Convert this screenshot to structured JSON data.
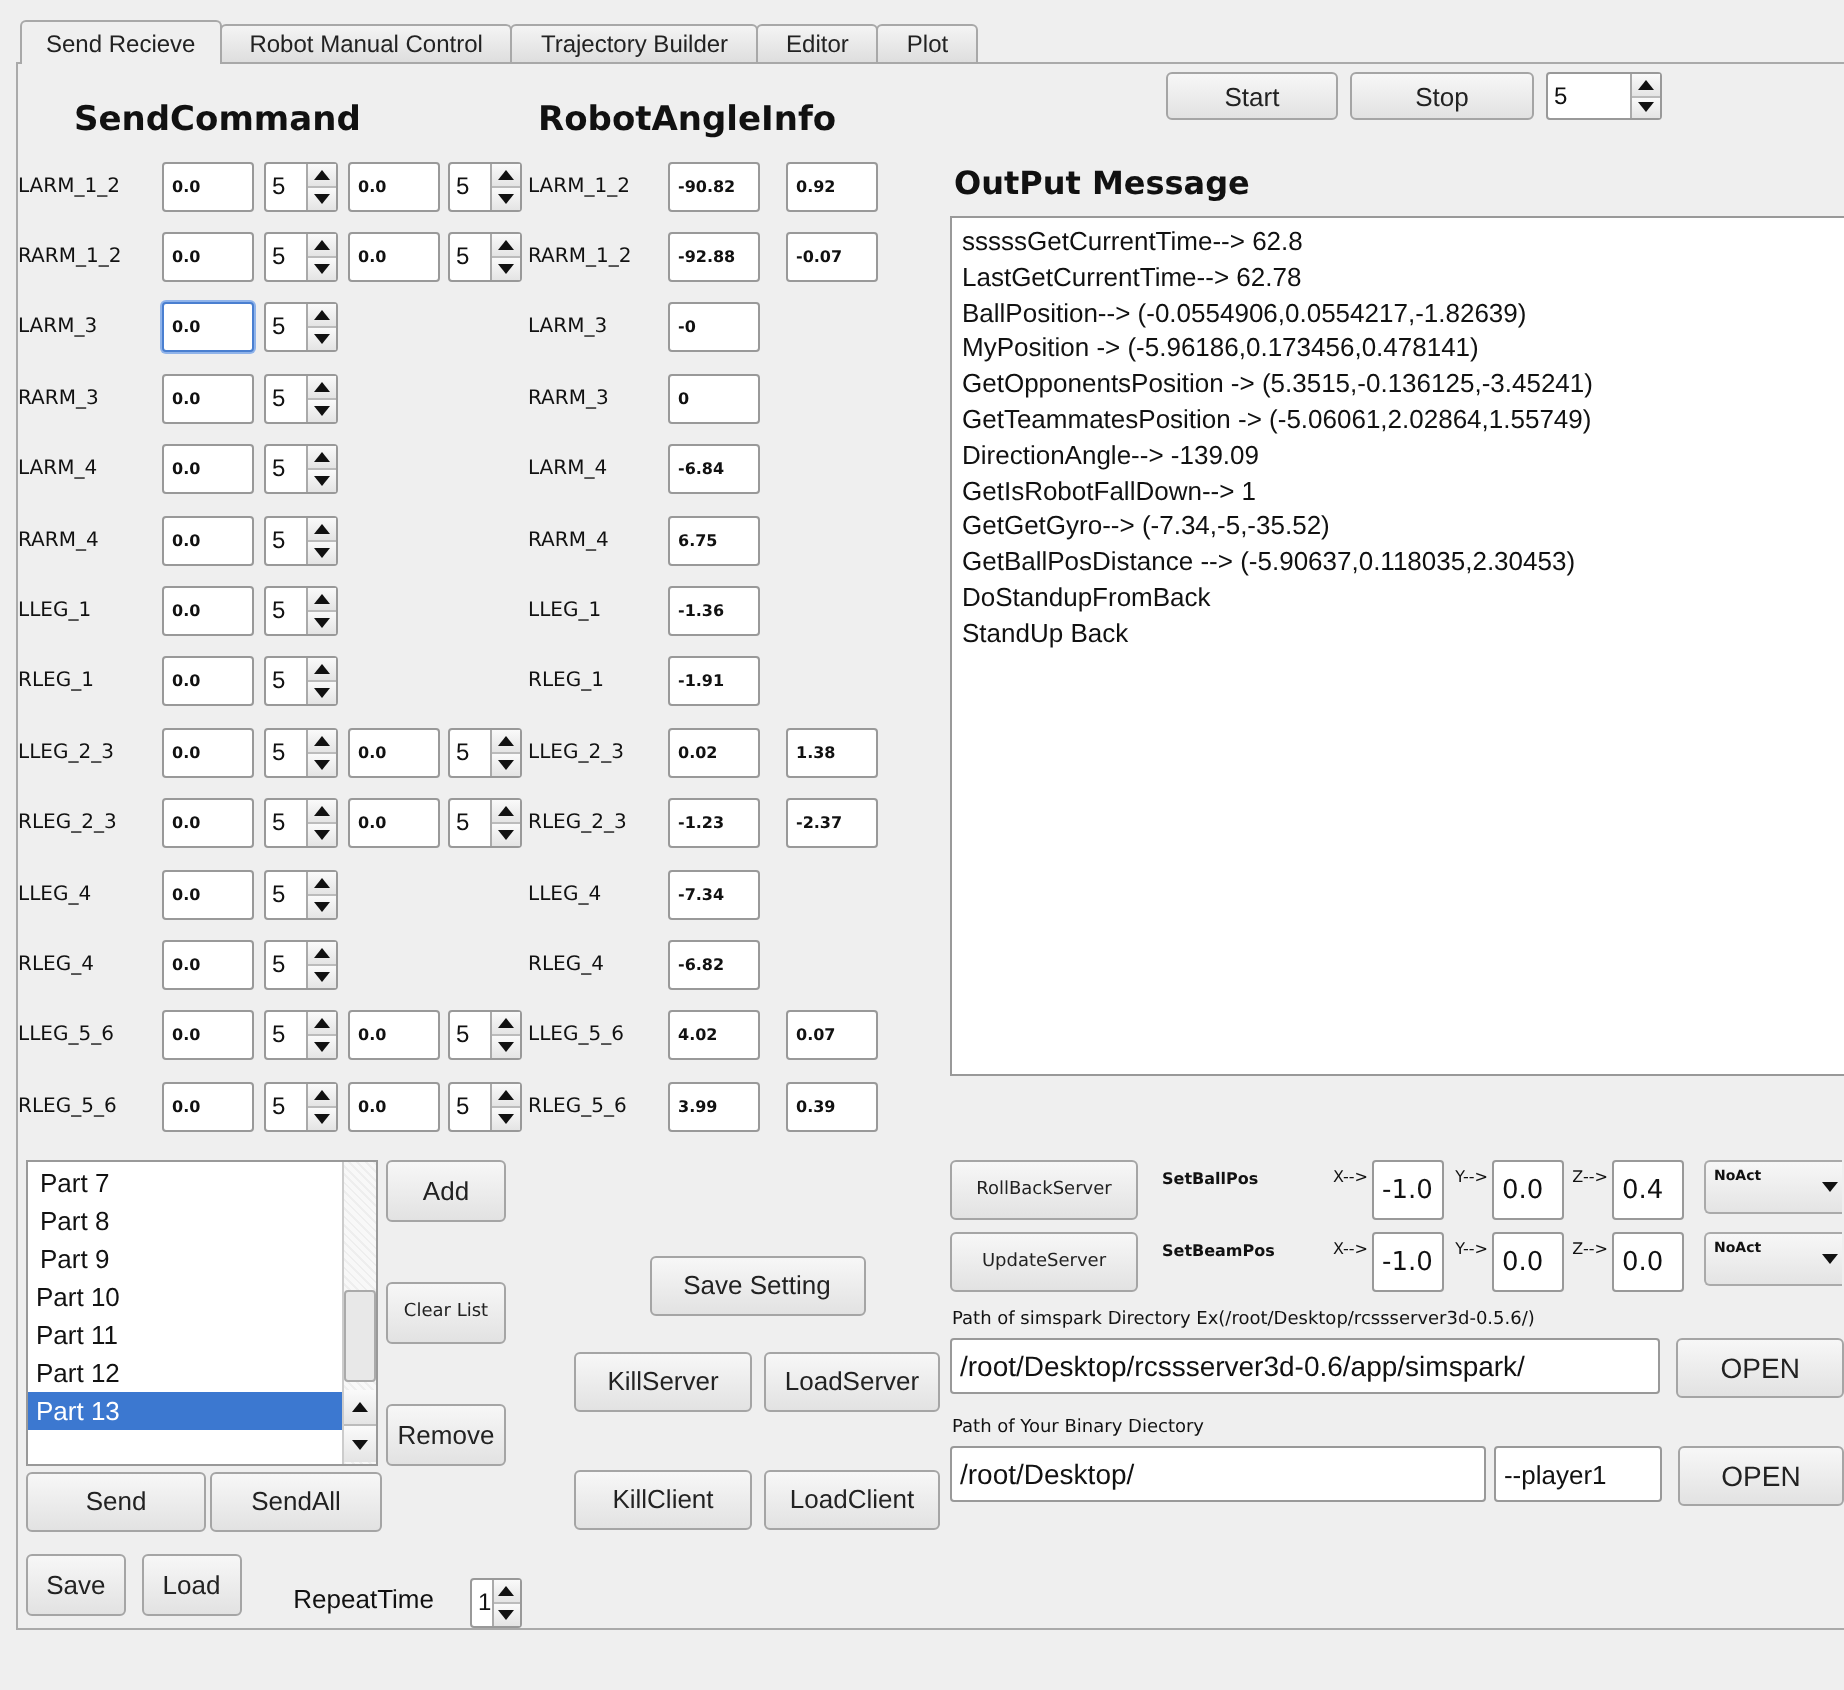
{
  "tabs": [
    {
      "label": "Send Recieve",
      "selected": true
    },
    {
      "label": "Robot Manual Control",
      "selected": false
    },
    {
      "label": "Trajectory Builder",
      "selected": false
    },
    {
      "label": "Editor",
      "selected": false
    },
    {
      "label": "Plot",
      "selected": false
    }
  ],
  "send_command": {
    "title": "SendCommand"
  },
  "robot_angle_info": {
    "title": "RobotAngleInfo"
  },
  "joints": [
    {
      "name": "LARM_1_2",
      "commands": [
        {
          "value": "0.0",
          "step": "5",
          "focused": false
        },
        {
          "value": "0.0",
          "step": "5",
          "focused": false
        }
      ],
      "angle_name": "LARM_1_2",
      "angles": [
        "-90.82",
        "0.92"
      ]
    },
    {
      "name": "RARM_1_2",
      "commands": [
        {
          "value": "0.0",
          "step": "5",
          "focused": false
        },
        {
          "value": "0.0",
          "step": "5",
          "focused": false
        }
      ],
      "angle_name": "RARM_1_2",
      "angles": [
        "-92.88",
        "-0.07"
      ]
    },
    {
      "name": "LARM_3",
      "commands": [
        {
          "value": "0.0",
          "step": "5",
          "focused": true
        }
      ],
      "angle_name": "LARM_3",
      "angles": [
        "-0"
      ]
    },
    {
      "name": "RARM_3",
      "commands": [
        {
          "value": "0.0",
          "step": "5",
          "focused": false
        }
      ],
      "angle_name": "RARM_3",
      "angles": [
        "0"
      ]
    },
    {
      "name": "LARM_4",
      "commands": [
        {
          "value": "0.0",
          "step": "5",
          "focused": false
        }
      ],
      "angle_name": "LARM_4",
      "angles": [
        "-6.84"
      ]
    },
    {
      "name": "RARM_4",
      "commands": [
        {
          "value": "0.0",
          "step": "5",
          "focused": false
        }
      ],
      "angle_name": "RARM_4",
      "angles": [
        "6.75"
      ]
    },
    {
      "name": "LLEG_1",
      "commands": [
        {
          "value": "0.0",
          "step": "5",
          "focused": false
        }
      ],
      "angle_name": "LLEG_1",
      "angles": [
        "-1.36"
      ]
    },
    {
      "name": "RLEG_1",
      "commands": [
        {
          "value": "0.0",
          "step": "5",
          "focused": false
        }
      ],
      "angle_name": "RLEG_1",
      "angles": [
        "-1.91"
      ]
    },
    {
      "name": "LLEG_2_3",
      "commands": [
        {
          "value": "0.0",
          "step": "5",
          "focused": false
        },
        {
          "value": "0.0",
          "step": "5",
          "focused": false
        }
      ],
      "angle_name": "LLEG_2_3",
      "angles": [
        "0.02",
        "1.38"
      ]
    },
    {
      "name": "RLEG_2_3",
      "commands": [
        {
          "value": "0.0",
          "step": "5",
          "focused": false
        },
        {
          "value": "0.0",
          "step": "5",
          "focused": false
        }
      ],
      "angle_name": "RLEG_2_3",
      "angles": [
        "-1.23",
        "-2.37"
      ]
    },
    {
      "name": "LLEG_4",
      "commands": [
        {
          "value": "0.0",
          "step": "5",
          "focused": false
        }
      ],
      "angle_name": "LLEG_4",
      "angles": [
        "-7.34"
      ]
    },
    {
      "name": "RLEG_4",
      "commands": [
        {
          "value": "0.0",
          "step": "5",
          "focused": false
        }
      ],
      "angle_name": "RLEG_4",
      "angles": [
        "-6.82"
      ]
    },
    {
      "name": "LLEG_5_6",
      "commands": [
        {
          "value": "0.0",
          "step": "5",
          "focused": false
        },
        {
          "value": "0.0",
          "step": "5",
          "focused": false
        }
      ],
      "angle_name": "LLEG_5_6",
      "angles": [
        "4.02",
        "0.07"
      ]
    },
    {
      "name": "RLEG_5_6",
      "commands": [
        {
          "value": "0.0",
          "step": "5",
          "focused": false
        },
        {
          "value": "0.0",
          "step": "5",
          "focused": false
        }
      ],
      "angle_name": "RLEG_5_6",
      "angles": [
        "3.99",
        "0.39"
      ]
    }
  ],
  "parts_list": {
    "items": [
      {
        "label": "Part 7",
        "selected": false
      },
      {
        "label": "Part 8",
        "selected": false
      },
      {
        "label": "Part 9",
        "selected": false
      },
      {
        "label": "Part 10",
        "selected": false
      },
      {
        "label": "Part 11",
        "selected": false
      },
      {
        "label": "Part 12",
        "selected": false
      },
      {
        "label": "Part 13",
        "selected": true
      }
    ],
    "side_buttons": [
      "Add",
      "Clear List",
      "Remove"
    ],
    "send_buttons": [
      "Send",
      "SendAll"
    ],
    "file_buttons": [
      "Save",
      "Load"
    ]
  },
  "repeat": {
    "label": "RepeatTime",
    "value": "1"
  },
  "save_setting": "Save Setting",
  "server_buttons": [
    [
      "KillServer",
      "LoadServer"
    ],
    [
      "KillClient",
      "LoadClient"
    ]
  ],
  "timer": {
    "buttons": [
      "Start",
      "Stop"
    ],
    "value": "5"
  },
  "output": {
    "title": "OutPut Message",
    "lines": [
      "sssssGetCurrentTime--> 62.8",
      "LastGetCurrentTime--> 62.78",
      "BallPosition--> (-0.0554906,0.0554217,-1.82639)",
      "MyPosition -> (-5.96186,0.173456,0.478141)",
      "GetOpponentsPosition -> (5.3515,-0.136125,-3.45241)",
      "GetTeammatesPosition -> (-5.06061,2.02864,1.55749)",
      "DirectionAngle--> -139.09",
      "GetIsRobotFallDown--> 1",
      "GetGetGyro--> (-7.34,-5,-35.52)",
      "GetBallPosDistance --> (-5.90637,0.118035,2.30453)",
      "DoStandupFromBack",
      "StandUp Back"
    ]
  },
  "position_rows": [
    {
      "button": "RollBackServer",
      "label": "SetBallPos",
      "axes": [
        {
          "label": "X-->",
          "value": "-1.0"
        },
        {
          "label": "Y-->",
          "value": "0.0"
        },
        {
          "label": "Z-->",
          "value": "0.4"
        }
      ],
      "action": "NoAct"
    },
    {
      "button": "UpdateServer",
      "label": "SetBeamPos",
      "axes": [
        {
          "label": "X-->",
          "value": "-1.0"
        },
        {
          "label": "Y-->",
          "value": "0.0"
        },
        {
          "label": "Z-->",
          "value": "0.0"
        }
      ],
      "action": "NoAct"
    }
  ],
  "simspark_path": {
    "label": "Path of simspark Directory Ex(/root/Desktop/rcssserver3d-0.5.6/)",
    "value": "/root/Desktop/rcssserver3d-0.6/app/simspark/",
    "button": "OPEN"
  },
  "binary_path": {
    "label": "Path of Your Binary Diectory",
    "value": "/root/Desktop/",
    "argument": "--player1",
    "button": "OPEN"
  }
}
